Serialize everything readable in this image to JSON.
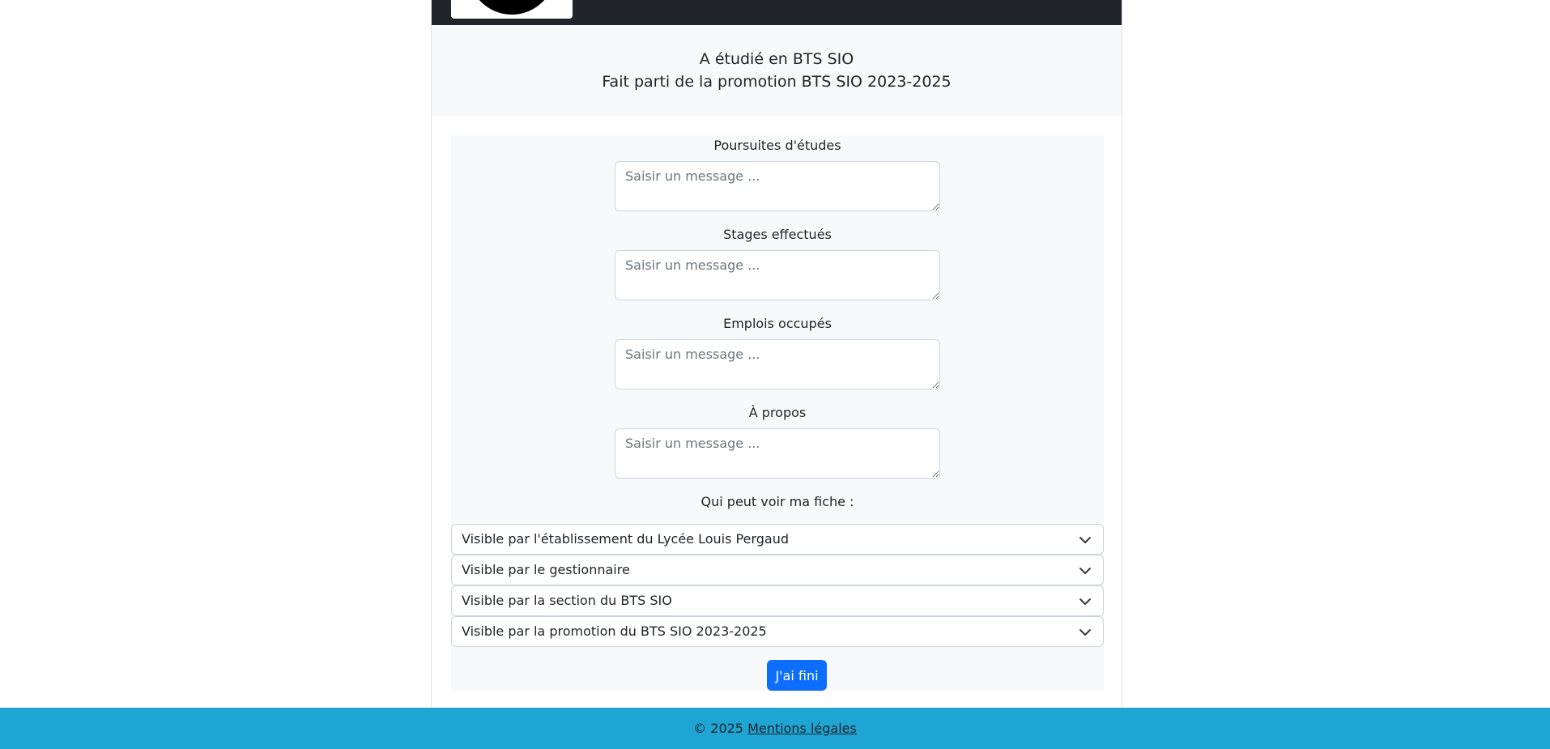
{
  "header": {
    "logo": "logo"
  },
  "info": {
    "line1": "A étudié en BTS SIO",
    "line2": "Fait parti de la promotion BTS SIO 2023-2025"
  },
  "form": {
    "fields": [
      {
        "label": "Poursuites d'études",
        "placeholder": "Saisir un message ..."
      },
      {
        "label": "Stages effectués",
        "placeholder": "Saisir un message ..."
      },
      {
        "label": "Emplois occupés",
        "placeholder": "Saisir un message ..."
      },
      {
        "label": "À propos",
        "placeholder": "Saisir un message ..."
      }
    ],
    "visibility_label": "Qui peut voir ma fiche :",
    "selects": [
      {
        "value": "Visible par l'établissement du Lycée Louis Pergaud"
      },
      {
        "value": "Visible par le gestionnaire"
      },
      {
        "value": "Visible par la section du BTS SIO"
      },
      {
        "value": "Visible par la promotion du BTS SIO 2023-2025"
      }
    ],
    "submit_label": "J'ai fini"
  },
  "footer": {
    "copyright": "© 2025",
    "legal_link": "Mentions légales"
  },
  "colors": {
    "navbar": "#212529",
    "footer": "#1ea5d4",
    "primary": "#0d6efd",
    "panel": "#f8f9fa"
  }
}
